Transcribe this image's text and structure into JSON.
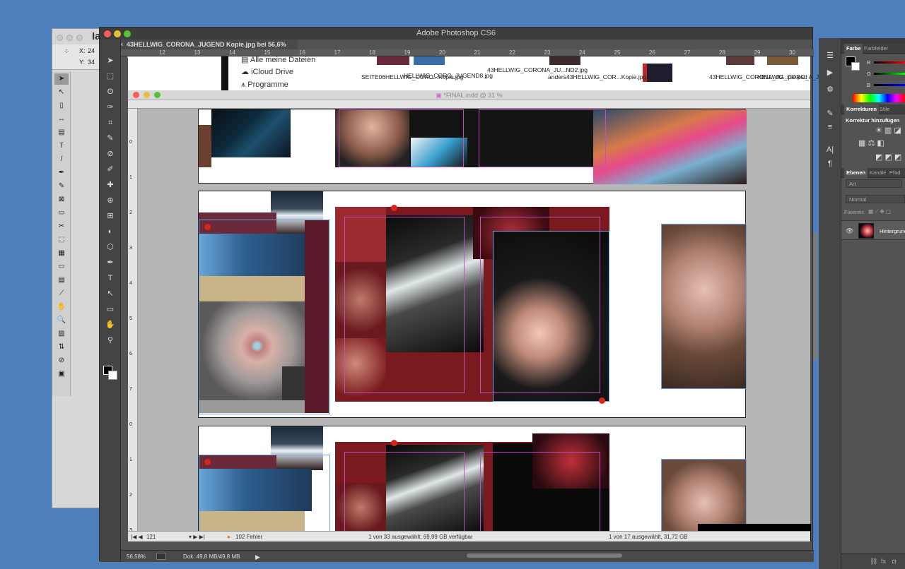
{
  "indesign_bg": {
    "title": "Ia",
    "x_label": "X:",
    "x_value": "24",
    "y_label": "Y:",
    "y_value": "34"
  },
  "photoshop": {
    "app_title": "Adobe Photoshop CS6",
    "doc_tab": "43HELLWIG_CORONA_JUGEND Kopie.jpg bei 56,6% (RGB/8)",
    "ruler_marks": [
      "12",
      "13",
      "14",
      "15",
      "16",
      "17",
      "18",
      "19",
      "20",
      "21",
      "22",
      "23",
      "24",
      "25",
      "26",
      "27",
      "28",
      "29",
      "30"
    ],
    "zoom": "56,58%",
    "doc_size": "Dok: 49,8 MB/49,8 MB",
    "left_ruler": [
      "8",
      "9"
    ]
  },
  "finder": {
    "sidebar": [
      "Alle meine Dateien",
      "iCloud Drive",
      "Programme"
    ],
    "files": [
      "SEITE06HELLWIG_CORO...Kopie.jpg",
      "HELLWIG_CORO_JUGEND8.jpg",
      "43HELLWIG_CORONA_JU...ND2.jpg",
      "anders43HELLWIG_COR...Kopie.jpg",
      "43HELLWIG_CORONA_JU...pie.psd",
      "HELLWIG_CORO_A_JUGEND9.jpg"
    ],
    "status_left": "1 von 33 ausgewählt, 69,99 GB verfügbar",
    "status_right": "1 von 17 ausgewählt, 31,72 GB"
  },
  "indesign": {
    "doc_title": "*FINAL.indd @ 31 %",
    "page_number": "121",
    "errors": "102 Fehler",
    "v_ruler": [
      "0",
      "1",
      "2",
      "3",
      "4",
      "5",
      "6",
      "7",
      "0",
      "1",
      "2",
      "3"
    ]
  },
  "panels": {
    "color_tabs": [
      "Farbe",
      "Farbfelder"
    ],
    "color_channels": [
      "R",
      "G",
      "B"
    ],
    "adjust_tabs": [
      "Korrekturen",
      "Stile"
    ],
    "adjust_title": "Korrektur hinzufügen",
    "layer_tabs": [
      "Ebenen",
      "Kanäle",
      "Pfad"
    ],
    "filter_kind": "Art",
    "blend_mode": "Normal",
    "lock_label": "Fixieren:",
    "layer_name": "Hintergrund"
  },
  "colors": {
    "accent_blue": "#6aa0e0",
    "error_red": "#d9261c",
    "frame_magenta": "#c34dc3",
    "desktop": "#4e7fbd"
  }
}
